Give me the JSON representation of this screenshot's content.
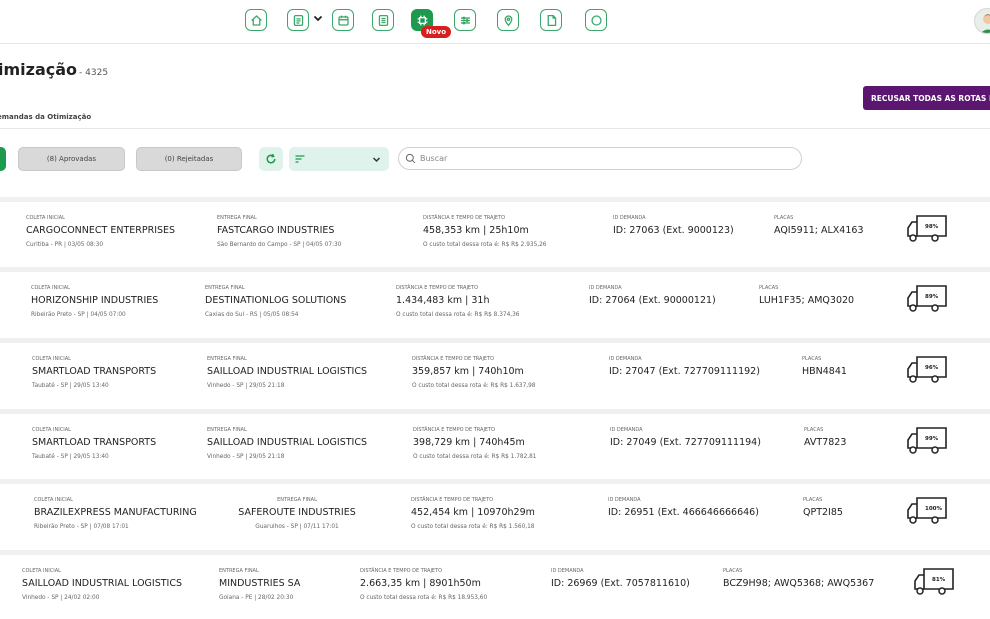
{
  "colors": {
    "brand_green": "#1e9a4e",
    "refuse_purple": "#5b1670",
    "novo_red": "#d81e1e"
  },
  "nav": {
    "icons": [
      "home-icon",
      "document-icon",
      "calendar-icon",
      "report-icon",
      "optimization-icon",
      "sliders-icon",
      "map-pin-icon",
      "file-icon",
      "chat-icon"
    ],
    "novo_badge": "Novo"
  },
  "header": {
    "title": "imização",
    "title_number": "- 4325",
    "subtitle": "emandas da Otimização"
  },
  "actions": {
    "refuse_all": "RECUSAR TODAS AS ROTAS P"
  },
  "filters": {
    "approved": "(8) Aprovadas",
    "rejected": "(0) Rejeitadas"
  },
  "search": {
    "placeholder": "Buscar",
    "value": ""
  },
  "labels": {
    "pickup": "COLETA INICIAL",
    "delivery": "ENTREGA FINAL",
    "distance": "DISTÂNCIA E TEMPO DE TRAJETO",
    "demand_id": "ID DEMANDA",
    "plates": "PLACAS"
  },
  "routes": [
    {
      "pickup_name": "CARGOCONNECT ENTERPRISES",
      "pickup_info": "Curitiba - PR | 03/05 08:30",
      "delivery_name": "FASTCARGO INDUSTRIES",
      "delivery_info": "São Bernardo do Campo - SP | 04/05 07:30",
      "distance": "458,353 km | 25h10m",
      "cost": "O custo total dessa rota é: R$ R$ 2.935,26",
      "demand_id": "ID: 27063 (Ext. 9000123)",
      "plates": "AQI5911; ALX4163",
      "occupancy": "98%"
    },
    {
      "pickup_name": "HORIZONSHIP INDUSTRIES",
      "pickup_info": "Ribeirão Preto - SP | 04/05 07:00",
      "delivery_name": "DESTINATIONLOG SOLUTIONS",
      "delivery_info": "Caxias do Sul - RS | 05/05 08:54",
      "distance": "1.434,483 km | 31h",
      "cost": "O custo total dessa rota é: R$ R$ 8.374,36",
      "demand_id": "ID: 27064 (Ext. 90000121)",
      "plates": "LUH1F35; AMQ3020",
      "occupancy": "89%"
    },
    {
      "pickup_name": "SMARTLOAD TRANSPORTS",
      "pickup_info": "Taubaté - SP | 29/05 13:40",
      "delivery_name": "SAILLOAD INDUSTRIAL LOGISTICS",
      "delivery_info": "Vinhedo - SP | 29/05 21:18",
      "distance": "359,857 km | 740h10m",
      "cost": "O custo total dessa rota é: R$ R$ 1.637,98",
      "demand_id": "ID: 27047 (Ext. 727709111192)",
      "plates": "HBN4841",
      "occupancy": "96%"
    },
    {
      "pickup_name": "SMARTLOAD TRANSPORTS",
      "pickup_info": "Taubaté - SP | 29/05 13:40",
      "delivery_name": "SAILLOAD INDUSTRIAL LOGISTICS",
      "delivery_info": "Vinhedo - SP | 29/05 21:18",
      "distance": "398,729 km | 740h45m",
      "cost": "O custo total dessa rota é: R$ R$ 1.782,81",
      "demand_id": "ID: 27049 (Ext. 727709111194)",
      "plates": "AVT7823",
      "occupancy": "99%"
    },
    {
      "pickup_name": "BRAZILEXPRESS MANUFACTURING",
      "pickup_info": "Ribeirão Preto - SP | 07/08 17:01",
      "delivery_name": "SAFEROUTE INDUSTRIES",
      "delivery_info": "Guarulhos - SP | 07/11 17:01",
      "distance": "452,454 km | 10970h29m",
      "cost": "O custo total dessa rota é: R$ R$ 1.560,18",
      "demand_id": "ID: 26951 (Ext. 466646666646)",
      "plates": "QPT2I85",
      "occupancy": "100%"
    },
    {
      "pickup_name": "SAILLOAD INDUSTRIAL LOGISTICS",
      "pickup_info": "Vinhedo - SP | 24/02 02:00",
      "delivery_name": "MINDUSTRIES SA",
      "delivery_info": "Goiana - PE | 28/02 20:30",
      "distance": "2.663,35 km | 8901h50m",
      "cost": "O custo total dessa rota é: R$ R$ 18.953,60",
      "demand_id": "ID: 26969 (Ext. 7057811610)",
      "plates": "BCZ9H98; AWQ5368; AWQ5367",
      "occupancy": "81%"
    }
  ]
}
